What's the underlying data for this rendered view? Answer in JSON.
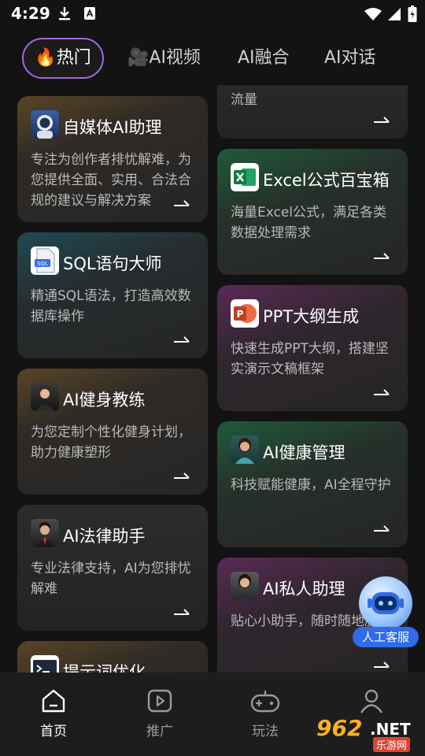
{
  "status_bar": {
    "time": "4:29"
  },
  "tabs": [
    {
      "label": "🔥热门"
    },
    {
      "label": "🎥AI视频"
    },
    {
      "label": "AI融合"
    },
    {
      "label": "AI对话"
    }
  ],
  "cards": [
    {
      "title": "",
      "desc": "流量"
    },
    {
      "title": "自媒体AI助理",
      "desc": "专注为创作者排忧解难，为您提供全面、实用、合法合规的建议与解决方案"
    },
    {
      "title": "Excel公式百宝箱",
      "desc": "海量Excel公式，满足各类数据处理需求"
    },
    {
      "title": "SQL语句大师",
      "desc": "精通SQL语法，打造高效数据库操作"
    },
    {
      "title": "PPT大纲生成",
      "desc": "快速生成PPT大纲，搭建坚实演示文稿框架"
    },
    {
      "title": "AI健身教练",
      "desc": "为您定制个性化健身计划，助力健康塑形"
    },
    {
      "title": "AI健康管理",
      "desc": "科技赋能健康，AI全程守护"
    },
    {
      "title": "AI法律助手",
      "desc": "专业法律支持，AI为您排忧解难"
    },
    {
      "title": "AI私人助理",
      "desc": "贴心小助手，随时随地服务"
    },
    {
      "title": "提示词优化",
      "desc": ""
    }
  ],
  "customer_service": {
    "label": "人工客服"
  },
  "bottom_nav": [
    {
      "label": "首页"
    },
    {
      "label": "推广"
    },
    {
      "label": "玩法"
    },
    {
      "label": ""
    }
  ],
  "watermark": {
    "number": "962",
    "net": ".NET",
    "site": "乐游网"
  }
}
